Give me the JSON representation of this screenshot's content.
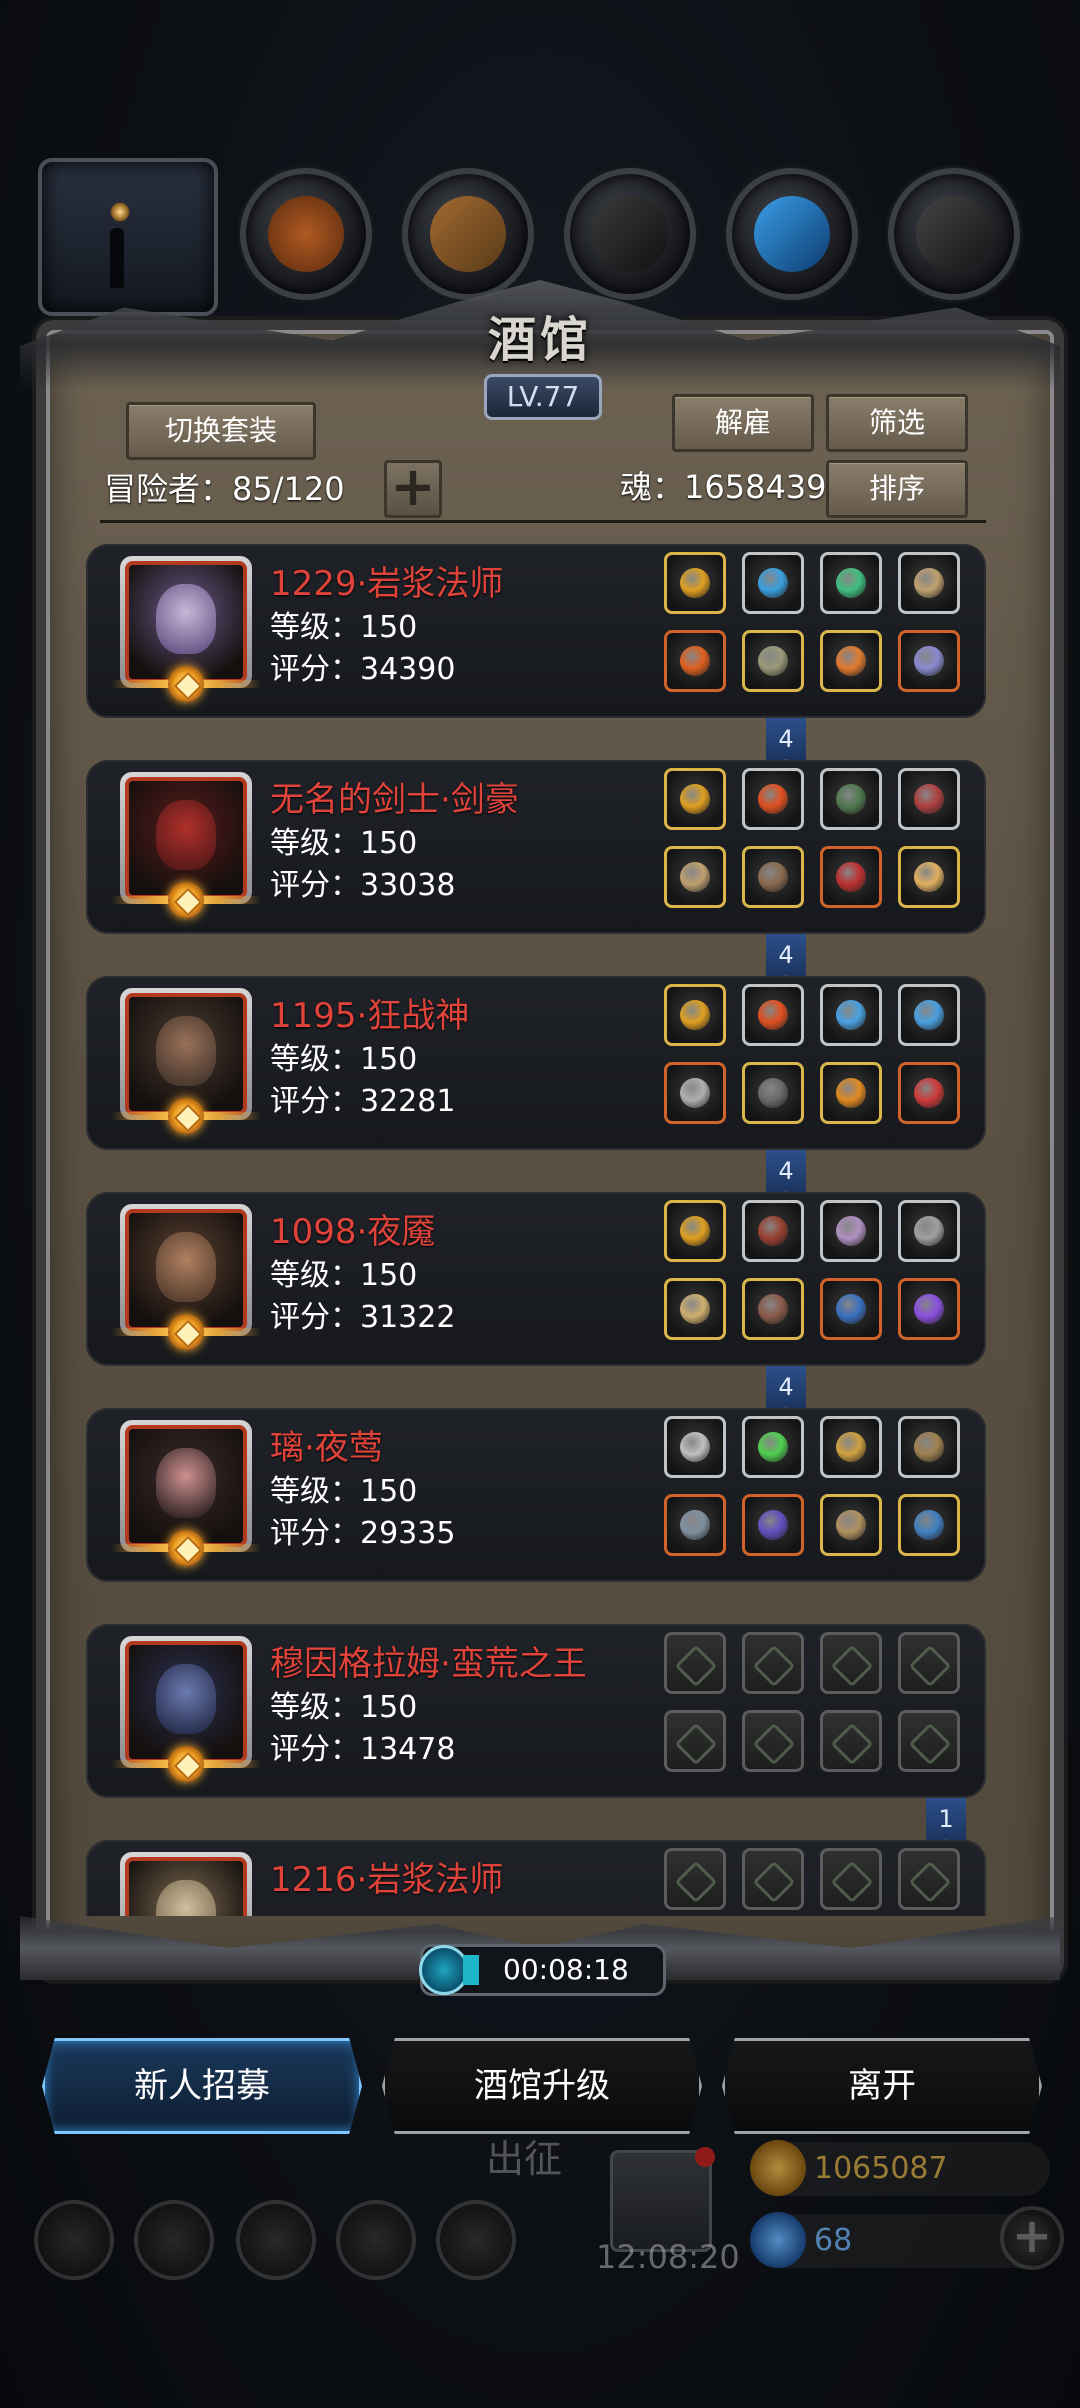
{
  "tavern": {
    "title": "酒馆",
    "level": "LV.77",
    "switch_set_label": "切换套装",
    "dismiss_label": "解雇",
    "filter_label": "筛选",
    "sort_label": "排序",
    "adventurers": "冒险者：85/120",
    "add_symbol": "+",
    "soul": "魂：1658439"
  },
  "heroes": [
    {
      "name": "1229·岩浆法师",
      "level": "等级：150",
      "score": "评分：34390",
      "set_count": "4",
      "portrait_color": "#6b5a8a",
      "face_color": "#c9b7d8",
      "slots": [
        [
          "gold",
          "#e0a020"
        ],
        [
          "silver",
          "#3aa0e0"
        ],
        [
          "silver",
          "#40c080"
        ],
        [
          "silver",
          "#c0a070"
        ],
        [
          "orange",
          "#e06020"
        ],
        [
          "gold",
          "#9a9a7a"
        ],
        [
          "gold",
          "#e07a30"
        ],
        [
          "orange",
          "#8a8ad0"
        ]
      ]
    },
    {
      "name": "无名的剑士·剑豪",
      "level": "等级：150",
      "score": "评分：33038",
      "set_count": "4",
      "portrait_color": "#5a1a1a",
      "face_color": "#b0302a",
      "slots": [
        [
          "gold",
          "#e0a020"
        ],
        [
          "silver",
          "#e05020"
        ],
        [
          "silver",
          "#507a50"
        ],
        [
          "silver",
          "#b04040"
        ],
        [
          "gold",
          "#c0a070"
        ],
        [
          "gold",
          "#8a6a50"
        ],
        [
          "orange",
          "#c03030"
        ],
        [
          "gold",
          "#e0b060"
        ]
      ]
    },
    {
      "name": "1195·狂战神",
      "level": "等级：150",
      "score": "评分：32281",
      "set_count": "4",
      "portrait_color": "#4a3a30",
      "face_color": "#9a7058",
      "slots": [
        [
          "gold",
          "#e0a020"
        ],
        [
          "silver",
          "#e05020"
        ],
        [
          "silver",
          "#4aa0e0"
        ],
        [
          "silver",
          "#4aa0e0"
        ],
        [
          "orange",
          "#b0b0b0"
        ],
        [
          "gold",
          "#6a6a6a"
        ],
        [
          "gold",
          "#e08a20"
        ],
        [
          "orange",
          "#d03a3a"
        ]
      ]
    },
    {
      "name": "1098·夜魇",
      "level": "等级：150",
      "score": "评分：31322",
      "set_count": "4",
      "portrait_color": "#5a4030",
      "face_color": "#b08060",
      "slots": [
        [
          "gold",
          "#e0a020"
        ],
        [
          "silver",
          "#9a4030"
        ],
        [
          "silver",
          "#b090c0"
        ],
        [
          "silver",
          "#a0a0a0"
        ],
        [
          "gold",
          "#d0b070"
        ],
        [
          "gold",
          "#8a5a4a"
        ],
        [
          "orange",
          "#3a70c0"
        ],
        [
          "orange",
          "#8a50e0"
        ]
      ]
    },
    {
      "name": "璃·夜莺",
      "level": "等级：150",
      "score": "评分：29335",
      "set_count": "",
      "portrait_color": "#3a2a2a",
      "face_color": "#d09090",
      "slots": [
        [
          "silver",
          "#c0c0c0"
        ],
        [
          "silver",
          "#50d050"
        ],
        [
          "silver",
          "#d0a040"
        ],
        [
          "silver",
          "#a08050"
        ],
        [
          "orange",
          "#8090a0"
        ],
        [
          "orange",
          "#6050c0"
        ],
        [
          "gold",
          "#b09060"
        ],
        [
          "gold",
          "#4080c0"
        ]
      ]
    },
    {
      "name": "穆因格拉姆·蛮荒之王",
      "level": "等级：150",
      "score": "评分：13478",
      "set_count": "1",
      "portrait_color": "#2a3050",
      "face_color": "#6a7ab0",
      "slots": [
        [
          "empty",
          ""
        ],
        [
          "empty",
          ""
        ],
        [
          "empty",
          ""
        ],
        [
          "empty",
          ""
        ],
        [
          "empty",
          ""
        ],
        [
          "empty",
          ""
        ],
        [
          "empty",
          ""
        ],
        [
          "empty",
          ""
        ]
      ]
    },
    {
      "name": "1216·岩浆法师",
      "level": "",
      "score": "",
      "set_count": "",
      "portrait_color": "#7a6a50",
      "face_color": "#d0c0a0",
      "slots": [
        [
          "empty",
          ""
        ],
        [
          "empty",
          ""
        ],
        [
          "empty",
          ""
        ],
        [
          "empty",
          ""
        ]
      ]
    }
  ],
  "timer": "00:08:18",
  "actions": {
    "recruit": "新人招募",
    "upgrade": "酒馆升级",
    "leave": "离开"
  },
  "background": {
    "march": "出征",
    "clock": "12:08:20",
    "gold": "1065087",
    "gems": "68",
    "plus": "+"
  },
  "colors": {
    "accent_blue": "#7ec6ff",
    "hero_name_red": "#e0433a",
    "panel": "#5b5244"
  }
}
